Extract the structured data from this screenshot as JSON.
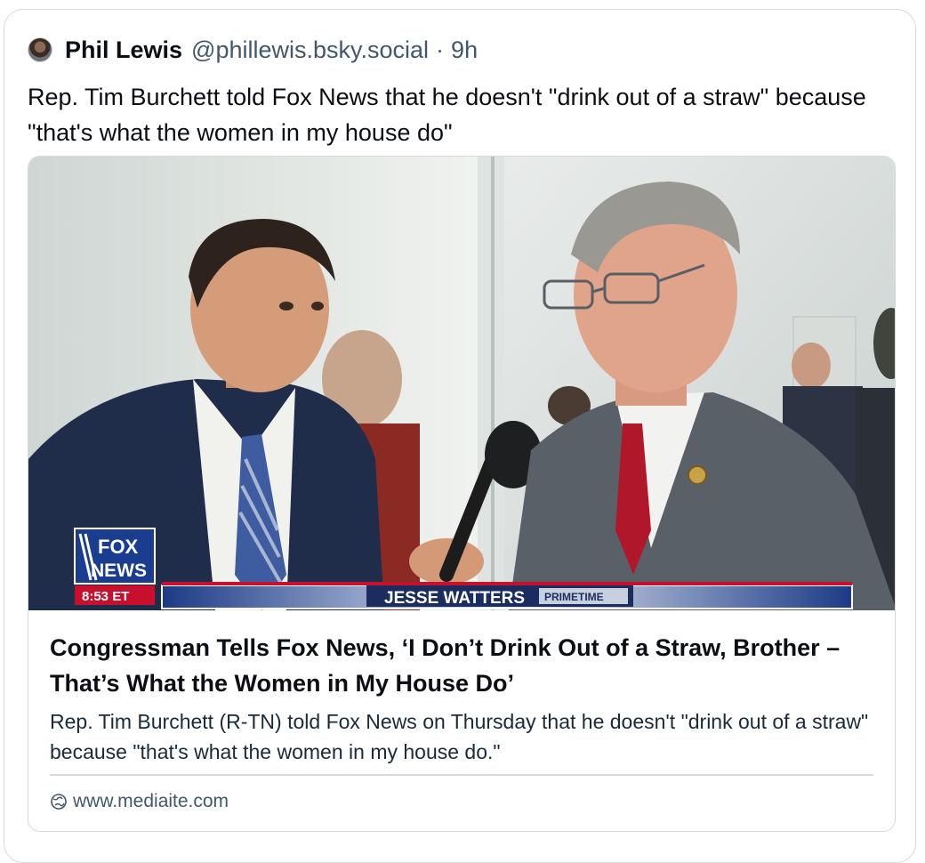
{
  "post": {
    "author": {
      "display_name": "Phil Lewis",
      "handle": "@phillewis.bsky.social",
      "separator": "·",
      "time": "9h",
      "avatar_icon": "user-avatar"
    },
    "text": "Rep. Tim Burchett told Fox News that he doesn't \"drink out of a straw\" because \"that's what the women in my house do\""
  },
  "embed": {
    "thumbnail": {
      "logo_top": "FOX",
      "logo_bottom": "NEWS",
      "time_badge": "8:53 ET",
      "show_name": "JESSE WATTERS",
      "show_tag": "PRIMETIME"
    },
    "title": "Congressman Tells Fox News, ‘I Don’t Drink Out of a Straw, Brother – That’s What the Women in My House Do’",
    "description": "Rep. Tim Burchett (R-TN) told Fox News on Thursday that he doesn't \"drink out of a straw\" because \"that's what the women in my house do.\"",
    "domain": "www.mediaite.com",
    "domain_icon": "globe-icon"
  },
  "colors": {
    "text_primary": "#0b0f14",
    "text_secondary": "#42576c",
    "border": "#d4d9df",
    "fox_blue": "#1a3d8f",
    "fox_red": "#c8102e"
  }
}
